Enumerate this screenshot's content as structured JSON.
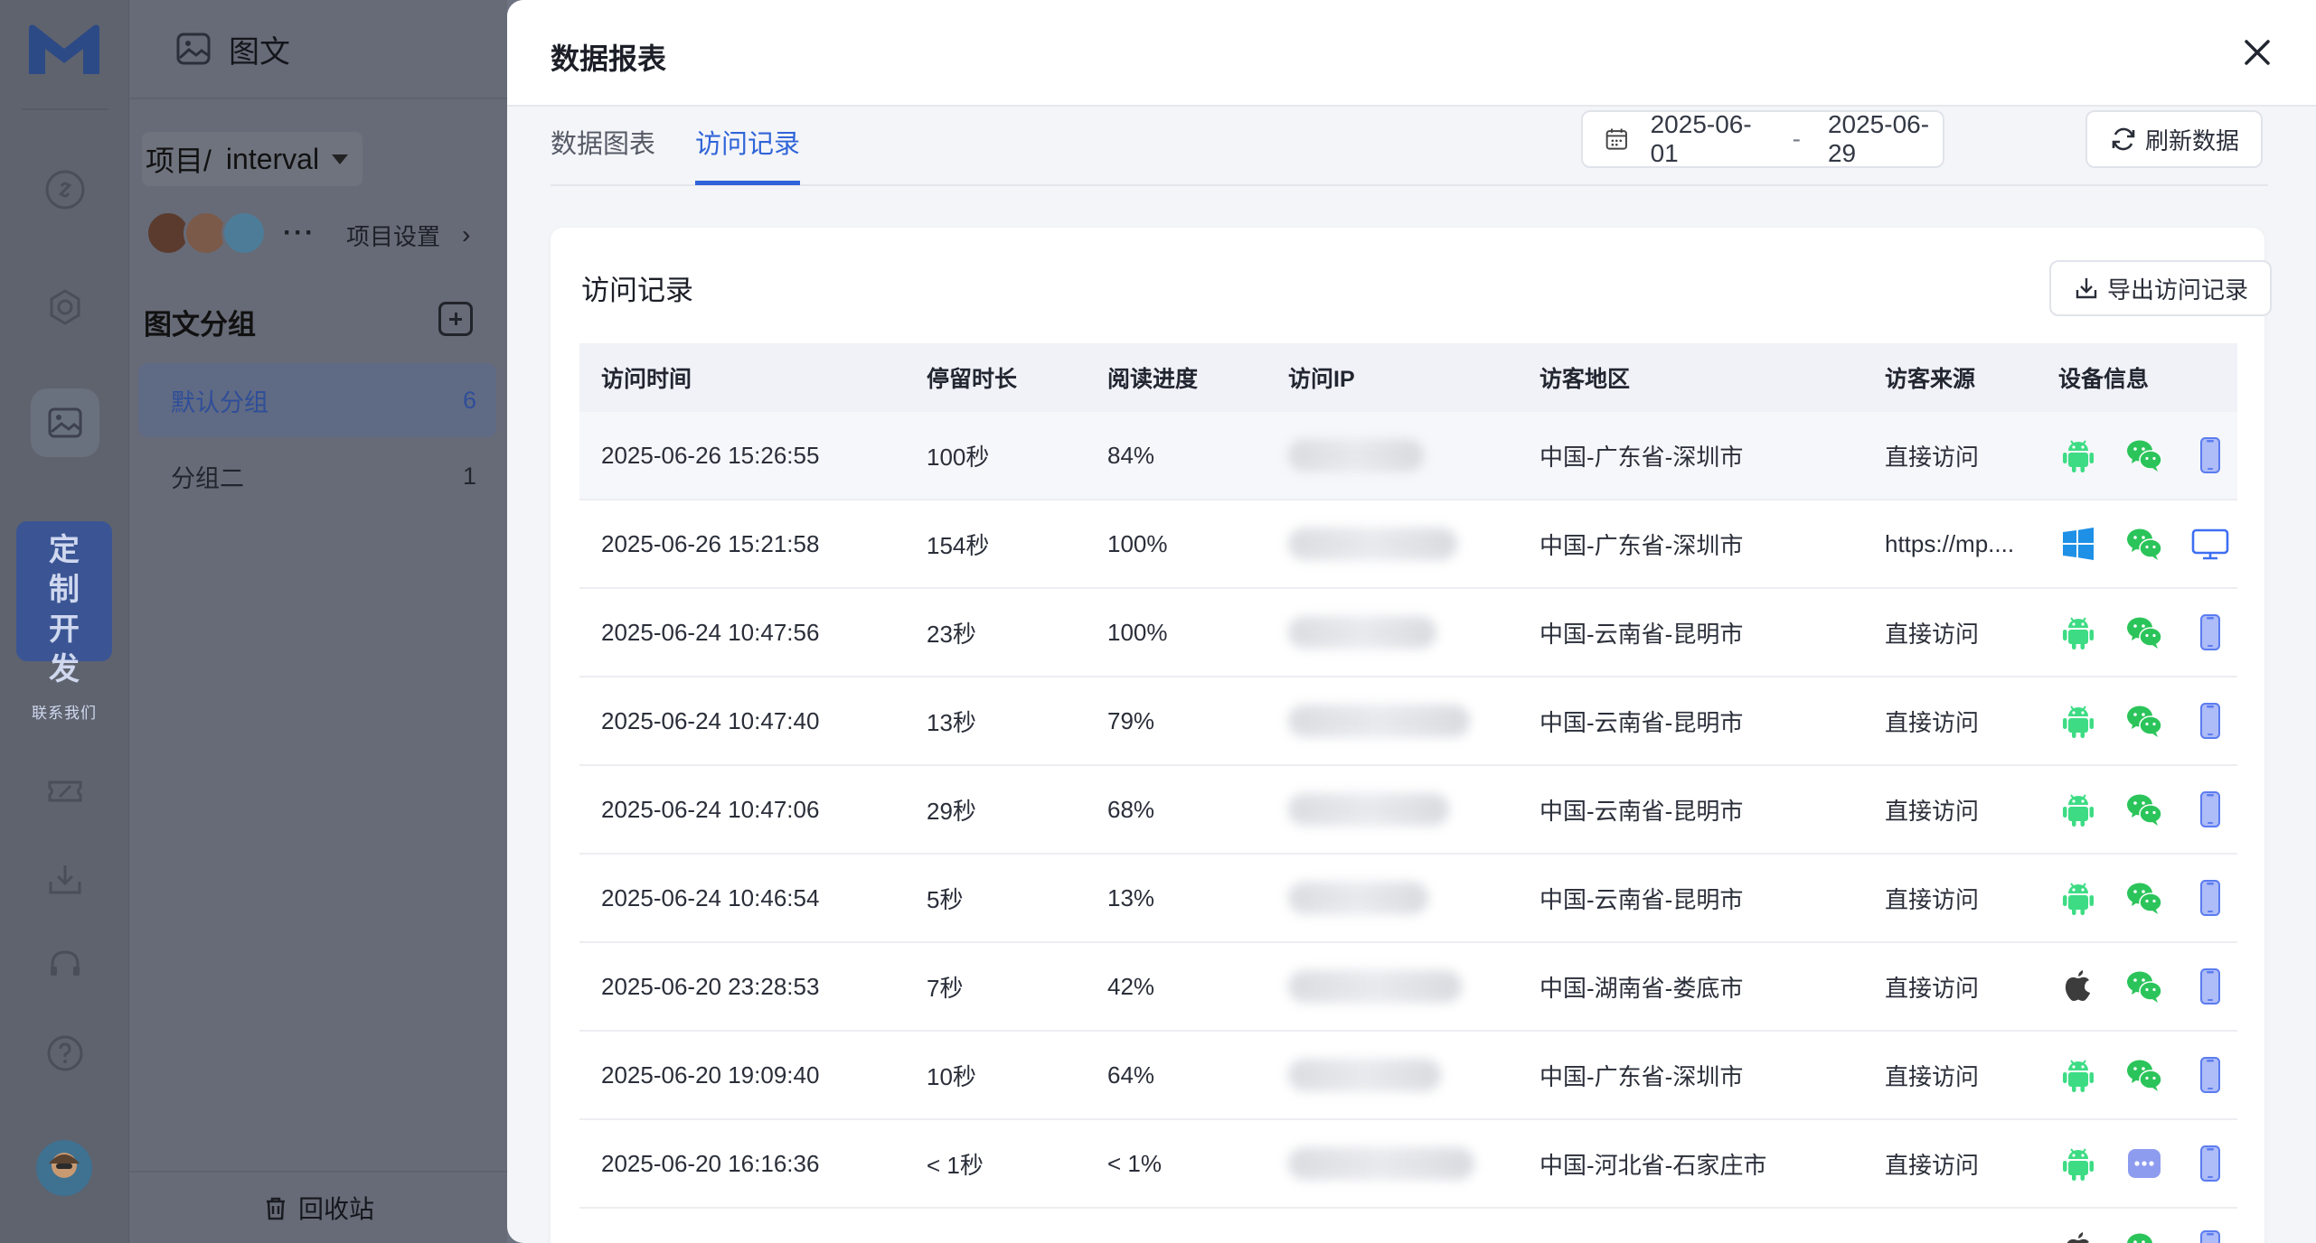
{
  "left_panel": {
    "section_title": "图文",
    "project_label": "项目/",
    "project_name": "interval",
    "more": "···",
    "project_settings": "项目设置",
    "group_title": "图文分组",
    "groups": [
      {
        "label": "默认分组",
        "count": "6"
      },
      {
        "label": "分组二",
        "count": "1"
      }
    ],
    "trash": "回收站"
  },
  "rail": {
    "promo_line1": "定 制",
    "promo_line2": "开 发",
    "promo_small": "联系我们"
  },
  "drawer": {
    "title": "数据报表",
    "tabs": [
      "数据图表",
      "访问记录"
    ],
    "active_tab": "访问记录",
    "date_start": "2025-06-01",
    "date_sep": "-",
    "date_end": "2025-06-29",
    "refresh_label": "刷新数据",
    "card_title": "访问记录",
    "export_label": "导出访问记录"
  },
  "table": {
    "columns": [
      "访问时间",
      "停留时长",
      "阅读进度",
      "访问IP",
      "访客地区",
      "访客来源",
      "设备信息"
    ],
    "rows": [
      {
        "time": "2025-06-26 15:26:55",
        "stay": "100秒",
        "progress": "84%",
        "region": "中国-广东省-深圳市",
        "source": "直接访问",
        "os": "android",
        "app": "wechat",
        "device": "mobile"
      },
      {
        "time": "2025-06-26 15:21:58",
        "stay": "154秒",
        "progress": "100%",
        "region": "中国-广东省-深圳市",
        "source": "https://mp....",
        "os": "windows",
        "app": "wechat",
        "device": "desktop"
      },
      {
        "time": "2025-06-24 10:47:56",
        "stay": "23秒",
        "progress": "100%",
        "region": "中国-云南省-昆明市",
        "source": "直接访问",
        "os": "android",
        "app": "wechat",
        "device": "mobile"
      },
      {
        "time": "2025-06-24 10:47:40",
        "stay": "13秒",
        "progress": "79%",
        "region": "中国-云南省-昆明市",
        "source": "直接访问",
        "os": "android",
        "app": "wechat",
        "device": "mobile"
      },
      {
        "time": "2025-06-24 10:47:06",
        "stay": "29秒",
        "progress": "68%",
        "region": "中国-云南省-昆明市",
        "source": "直接访问",
        "os": "android",
        "app": "wechat",
        "device": "mobile"
      },
      {
        "time": "2025-06-24 10:46:54",
        "stay": "5秒",
        "progress": "13%",
        "region": "中国-云南省-昆明市",
        "source": "直接访问",
        "os": "android",
        "app": "wechat",
        "device": "mobile"
      },
      {
        "time": "2025-06-20 23:28:53",
        "stay": "7秒",
        "progress": "42%",
        "region": "中国-湖南省-娄底市",
        "source": "直接访问",
        "os": "apple",
        "app": "wechat",
        "device": "mobile"
      },
      {
        "time": "2025-06-20 19:09:40",
        "stay": "10秒",
        "progress": "64%",
        "region": "中国-广东省-深圳市",
        "source": "直接访问",
        "os": "android",
        "app": "wechat",
        "device": "mobile"
      },
      {
        "time": "2025-06-20 16:16:36",
        "stay": "< 1秒",
        "progress": "< 1%",
        "region": "中国-河北省-石家庄市",
        "source": "直接访问",
        "os": "android",
        "app": "other-browser",
        "device": "mobile"
      }
    ],
    "partial_row": {
      "os": "apple",
      "app": "wechat",
      "device": "mobile"
    }
  },
  "colors": {
    "accent": "#2f64d9",
    "android": "#3ddc84",
    "wechat": "#2bc45a",
    "device_icon": "#5b7cf0"
  }
}
